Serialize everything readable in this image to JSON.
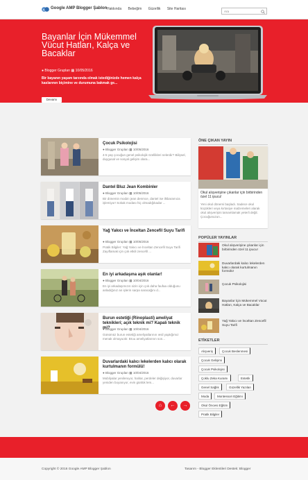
{
  "brand": {
    "name": "Google AMP Blogger Şablon"
  },
  "nav": {
    "items": [
      "Hakkında",
      "Bebeğim",
      "Güzellik",
      "Site Haritası"
    ]
  },
  "search": {
    "placeholder": "Ara"
  },
  "hero": {
    "title": "Bayanlar İçin Mükemmel Vücut Hatları, Kalça ve Bacaklar",
    "author": "Blogger Grupları",
    "date": "10/05/2016",
    "description": "Bir bayanın yaşam tarzında olmak istediğinizde hemen kalça kaslarının biçimine ve durumuna bakmak ge...",
    "button": "Devamı"
  },
  "posts": [
    {
      "title": "Çocuk Psikolojisi",
      "author": "Blogger Grupları",
      "date": "10/05/2016",
      "excerpt": "4-5 yaş çocuğun genel psikolojik özellikleri nelerdir? Bilişsel, duygusal ve sosyal gelişim olara..."
    },
    {
      "title": "Dantel Bluz Jean Kombinler",
      "author": "Blogger Grupları",
      "date": "10/05/2016",
      "excerpt": "Bir dönemin moda'ı jean denmce, dantel ise ilkbaramıza işlemiyor! Sokak modası hiç olmadığıkadar ..."
    },
    {
      "title": "Yağ Yakıcı ve İnceltan Zencefil Suyu Tarifi",
      "author": "Blogger Grupları",
      "date": "10/05/2016",
      "excerpt": "Pratik Bilgiler: Yağ Yakıcı ve İnceltan Zencefil Suyu Tarifi Zayıflamak için çok etkili zencefil ..."
    },
    {
      "title": "En iyi arkadaşına aşık olanlar!",
      "author": "Blogger Grupları",
      "date": "10/04/2016",
      "excerpt": "En iyi arkadaşımızın sizin için çok daha faufaa olduğunu anladığınız an işlerin sarpa saracağını d..."
    },
    {
      "title": "Burun estetiği (Rinoplasti) ameliyat teknikleri; açık teknik mi? Kapalı teknik mi?",
      "author": "Blogger Grupları",
      "date": "10/04/2016",
      "excerpt": "Günümüz burun estetiği ameliyatlarının ıesil yaptığımız menak olmayuotir. Bruu ameliyatlarının son..."
    },
    {
      "title": "Duvarlardaki kalıcı lekelerden kalıcı olarak kurtulmanın formülü!",
      "author": "Blogger Grupları",
      "date": "10/04/2016",
      "excerpt": "Mobilyalar yenilenıyor, halılar, perdeler değişiyor, duvarlar yeniden boyanıyor, evin günlük lem..."
    }
  ],
  "pager": {
    "home": "⌂",
    "prev": "←",
    "next": "→"
  },
  "sidebar": {
    "featured_heading": "ÖNE ÇIKAN YAYIN",
    "featured": {
      "title": "Okul alışverişine çıkanlar için birbirinden özel 11 ipucu!",
      "excerpt": "Yeni okul dönemi başladı. Sadece okul küçükleri veya kırtasiye malzemeleri alarak okul alışverişini tamamlamak yeterli değil. Çocuğunuzun..."
    },
    "popular_heading": "POPÜLER YAYINLAR",
    "popular": [
      "Okul alışverişine çıkanlar için birbirinden özel 11 ipucu!",
      "Duvarlardaki kalıcı lekelerden kalıcı olarak kurtulmanın formülü!",
      "Çocuk Psikolojisi",
      "Bayanlar İçin Mükemmel Vücut Hatları, Kalça ve Bacaklar",
      "Yağ Yakıcı ve İnceltan Zencefil Suyu Tarifi"
    ],
    "tags_heading": "ETİKETLER",
    "tags": [
      "Alışveriş",
      "Çocuk Beslenmesi",
      "Çocuk Gelişimi",
      "Çocuk Psikolojisi",
      "Çoklu Zeka Kuramı",
      "Estetik",
      "Genel Sağlık",
      "Güzellik Yazıları",
      "Moda",
      "Montessori Eğitimi",
      "Okul Öncesi Eğitim",
      "Pratik Bilgiler"
    ]
  },
  "footer": {
    "copyright": "Copyright © 2016 Google AMP Blogger Şablon",
    "credit": "Tasarım - Blogger Eklentileri Destek: Blogger"
  },
  "colors": {
    "accent": "#e8202a"
  }
}
